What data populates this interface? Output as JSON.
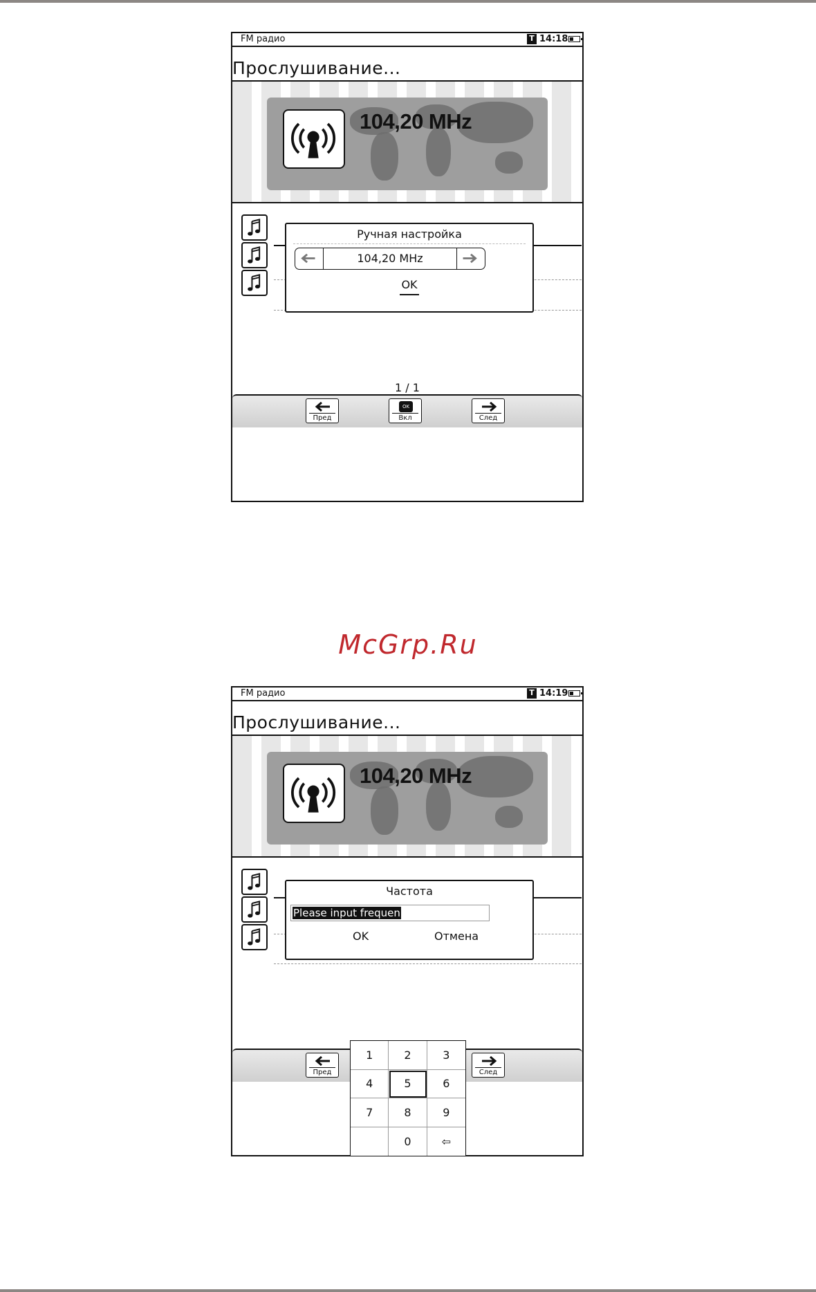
{
  "watermark": "McGrp.Ru",
  "screens": [
    {
      "status": {
        "title": "FM радио",
        "t_badge": "T",
        "time": "14:18",
        "battery_level": 0.4
      },
      "heading": "Прослушивание...",
      "banner": {
        "frequency": "104,20 MHz",
        "icon": "radio-tower-icon"
      },
      "side_icons": [
        "music-note-icon",
        "music-note-icon",
        "music-note-icon"
      ],
      "dialog": {
        "title": "Ручная настройка",
        "left_icon": "arrow-left-icon",
        "value": "104,20 MHz",
        "right_icon": "arrow-right-icon",
        "ok": "OK"
      },
      "page_indicator": "1 / 1",
      "nav": {
        "prev": "Пред",
        "on": "Вкл",
        "ok_chip": "OK",
        "next": "След"
      }
    },
    {
      "status": {
        "title": "FM радио",
        "t_badge": "T",
        "time": "14:19",
        "battery_level": 0.4
      },
      "heading": "Прослушивание...",
      "banner": {
        "frequency": "104,20 MHz",
        "icon": "radio-tower-icon"
      },
      "side_icons": [
        "music-note-icon",
        "music-note-icon",
        "music-note-icon"
      ],
      "dialog": {
        "title": "Частота",
        "input_value": "Please input frequen",
        "ok": "OK",
        "cancel": "Отмена"
      },
      "nav": {
        "prev": "Пред",
        "next": "След"
      },
      "keypad": [
        "1",
        "2",
        "3",
        "4",
        "5",
        "6",
        "7",
        "8",
        "9",
        "",
        "0",
        "⇦"
      ],
      "keypad_selected": "5"
    }
  ]
}
